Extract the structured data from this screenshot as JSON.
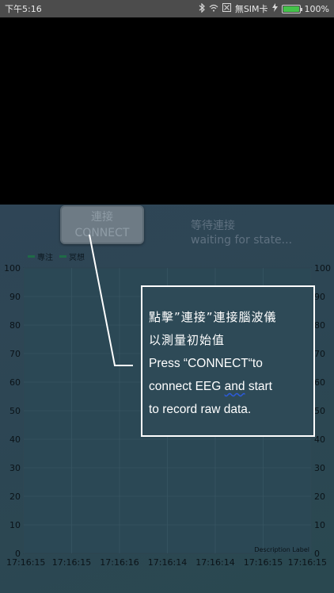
{
  "status_bar": {
    "time": "下午5:16",
    "bluetooth_icon": "bluetooth-icon",
    "wifi_icon": "wifi-icon",
    "sim_text": "無SIM卡",
    "battery_percent": "100%",
    "battery_level": 1.0,
    "battery_color": "#44c24a"
  },
  "connect_button": {
    "label_zh": "連接",
    "label_en": "CONNECT"
  },
  "status": {
    "label_zh": "等待連接",
    "label_en": "waiting for state..."
  },
  "chart_data": {
    "type": "line",
    "series": [
      {
        "name": "專注",
        "color": "#1f6b47",
        "values": []
      },
      {
        "name": "冥想",
        "color": "#1f6b47",
        "values": []
      }
    ],
    "categories": [
      "17:16:15",
      "17:16:15",
      "17:16:16",
      "17:16:14",
      "17:16:14",
      "17:16:15",
      "17:16:15"
    ],
    "y_ticks": [
      "0",
      "10",
      "20",
      "30",
      "40",
      "50",
      "60",
      "70",
      "80",
      "90",
      "100"
    ],
    "ylim": [
      0,
      100
    ],
    "description_label": "Description Label",
    "grid": true,
    "legend_position": "top-left"
  },
  "callout": {
    "line1": "點擊”連接”連接腦波儀",
    "line2": "以測量初始值",
    "line3": "Press “CONNECT“to",
    "line4_a": "connect EEG ",
    "line4_b": "and",
    "line4_c": "  start",
    "line5": "to record raw data."
  }
}
